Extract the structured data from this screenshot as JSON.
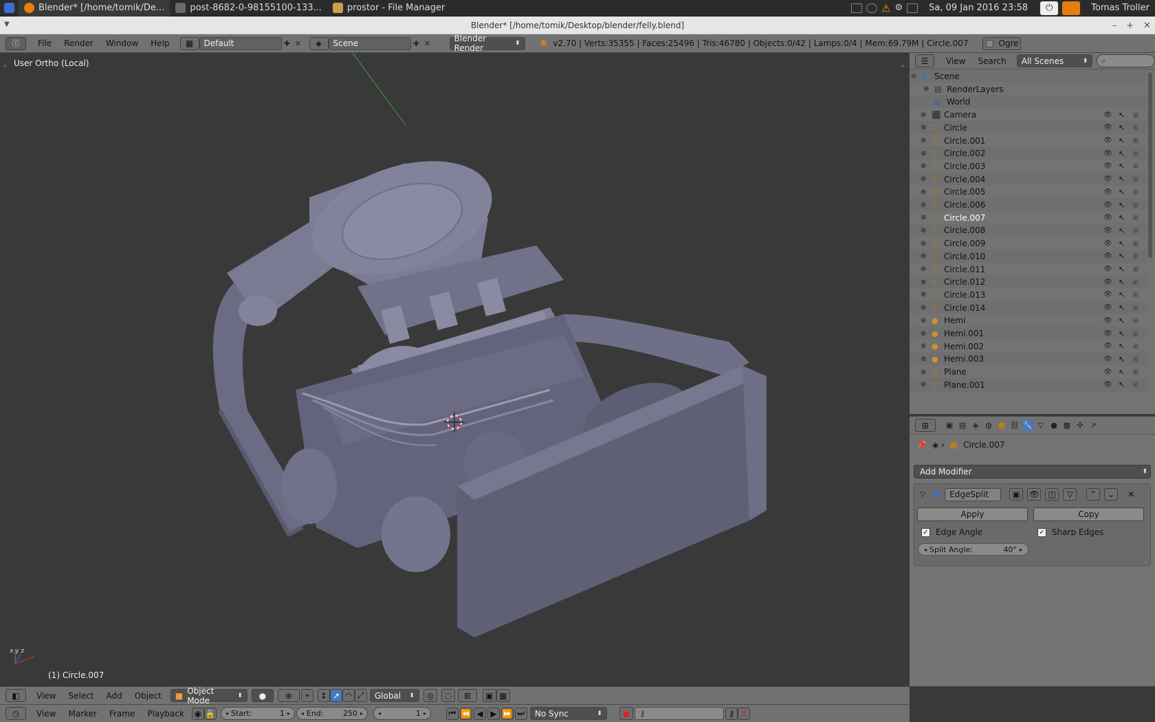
{
  "taskbar": {
    "tasks": [
      {
        "label": "Blender* [/home/tomik/De..."
      },
      {
        "label": "post-8682-0-98155100-133..."
      },
      {
        "label": "prostor - File Manager"
      }
    ],
    "datetime": "Sa, 09 Jan 2016 23:58",
    "user": "Tomas Troller"
  },
  "window": {
    "title": "Blender* [/home/tomik/Desktop/blender/felly.blend]"
  },
  "header": {
    "menus": [
      "File",
      "Render",
      "Window",
      "Help"
    ],
    "screen": "Default",
    "scene": "Scene",
    "engine": "Blender Render",
    "stats": "v2.70 | Verts:35355 | Faces:25496 | Tris:46780 | Objects:0/42 | Lamps:0/4 | Mem:69.79M | Circle.007",
    "ogre_label": "Ogre"
  },
  "viewport": {
    "view_label": "User Ortho (Local)",
    "object_label": "(1) Circle.007"
  },
  "outliner": {
    "view_label": "View",
    "search_label": "Search",
    "scenes_dropdown": "All Scenes",
    "items": [
      {
        "label": "Scene",
        "type": "scene"
      },
      {
        "label": "RenderLayers",
        "type": "renderlayers"
      },
      {
        "label": "World",
        "type": "world"
      },
      {
        "label": "Camera",
        "type": "camera"
      },
      {
        "label": "Circle",
        "type": "mesh"
      },
      {
        "label": "Circle.001",
        "type": "mesh"
      },
      {
        "label": "Circle.002",
        "type": "mesh"
      },
      {
        "label": "Circle.003",
        "type": "mesh"
      },
      {
        "label": "Circle.004",
        "type": "mesh"
      },
      {
        "label": "Circle.005",
        "type": "mesh"
      },
      {
        "label": "Circle.006",
        "type": "mesh"
      },
      {
        "label": "Circle.007",
        "type": "mesh",
        "selected": true
      },
      {
        "label": "Circle.008",
        "type": "mesh"
      },
      {
        "label": "Circle.009",
        "type": "mesh"
      },
      {
        "label": "Circle.010",
        "type": "mesh"
      },
      {
        "label": "Circle.011",
        "type": "mesh"
      },
      {
        "label": "Circle.012",
        "type": "mesh"
      },
      {
        "label": "Circle.013",
        "type": "mesh"
      },
      {
        "label": "Circle.014",
        "type": "mesh"
      },
      {
        "label": "Hemi",
        "type": "lamp"
      },
      {
        "label": "Hemi.001",
        "type": "lamp"
      },
      {
        "label": "Hemi.002",
        "type": "lamp"
      },
      {
        "label": "Hemi.003",
        "type": "lamp"
      },
      {
        "label": "Plane",
        "type": "mesh"
      },
      {
        "label": "Plane.001",
        "type": "mesh"
      }
    ]
  },
  "properties": {
    "context_object": "Circle.007",
    "add_modifier_label": "Add Modifier",
    "modifier": {
      "name": "EdgeSplit",
      "apply_label": "Apply",
      "copy_label": "Copy",
      "edge_angle_label": "Edge Angle",
      "sharp_edges_label": "Sharp Edges",
      "split_angle_label": "Split Angle:",
      "split_angle_value": "40°"
    }
  },
  "view3d_header": {
    "menus": [
      "View",
      "Select",
      "Add",
      "Object"
    ],
    "mode": "Object Mode",
    "orientation": "Global"
  },
  "timeline": {
    "menus": [
      "View",
      "Marker",
      "Frame",
      "Playback"
    ],
    "start_label": "Start:",
    "start_value": "1",
    "end_label": "End:",
    "end_value": "250",
    "current_frame": "1",
    "sync": "No Sync"
  }
}
